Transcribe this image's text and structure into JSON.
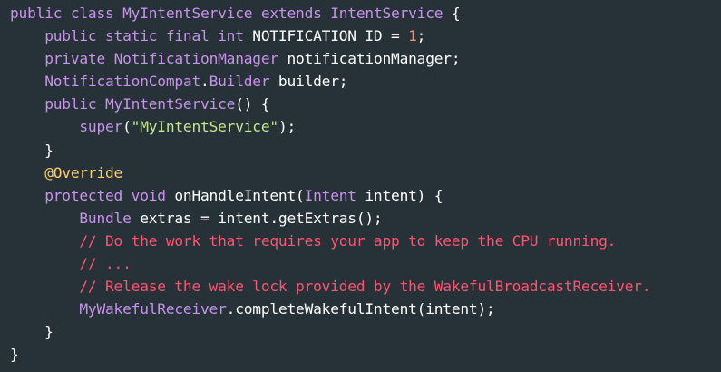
{
  "colors": {
    "background": "#263238",
    "keyword": "#c792ea",
    "type": "#c792ea",
    "plain": "#ffffff",
    "string": "#c3e88d",
    "number": "#f78c6c",
    "annotation": "#ffcb6b",
    "comment": "#ff5370"
  },
  "code": {
    "lines": [
      [
        {
          "cls": "tok-kw",
          "t": "public class "
        },
        {
          "cls": "tok-type",
          "t": "MyIntentService"
        },
        {
          "cls": "tok-kw",
          "t": " extends "
        },
        {
          "cls": "tok-type",
          "t": "IntentService"
        },
        {
          "cls": "tok-plain",
          "t": " {"
        }
      ],
      [
        {
          "cls": "tok-plain",
          "t": "    "
        },
        {
          "cls": "tok-kw",
          "t": "public static final int"
        },
        {
          "cls": "tok-plain",
          "t": " NOTIFICATION_ID = "
        },
        {
          "cls": "tok-num",
          "t": "1"
        },
        {
          "cls": "tok-plain",
          "t": ";"
        }
      ],
      [
        {
          "cls": "tok-plain",
          "t": "    "
        },
        {
          "cls": "tok-kw",
          "t": "private "
        },
        {
          "cls": "tok-type",
          "t": "NotificationManager"
        },
        {
          "cls": "tok-plain",
          "t": " notificationManager;"
        }
      ],
      [
        {
          "cls": "tok-plain",
          "t": "    "
        },
        {
          "cls": "tok-type",
          "t": "NotificationCompat"
        },
        {
          "cls": "tok-plain",
          "t": "."
        },
        {
          "cls": "tok-type",
          "t": "Builder"
        },
        {
          "cls": "tok-plain",
          "t": " builder;"
        }
      ],
      [
        {
          "cls": "tok-plain",
          "t": "    "
        },
        {
          "cls": "tok-kw",
          "t": "public "
        },
        {
          "cls": "tok-type",
          "t": "MyIntentService"
        },
        {
          "cls": "tok-plain",
          "t": "() {"
        }
      ],
      [
        {
          "cls": "tok-plain",
          "t": "        "
        },
        {
          "cls": "tok-kw",
          "t": "super"
        },
        {
          "cls": "tok-plain",
          "t": "("
        },
        {
          "cls": "tok-str",
          "t": "\"MyIntentService\""
        },
        {
          "cls": "tok-plain",
          "t": ");"
        }
      ],
      [
        {
          "cls": "tok-plain",
          "t": "    }"
        }
      ],
      [
        {
          "cls": "tok-plain",
          "t": "    "
        },
        {
          "cls": "tok-ann",
          "t": "@Override"
        }
      ],
      [
        {
          "cls": "tok-plain",
          "t": "    "
        },
        {
          "cls": "tok-kw",
          "t": "protected void"
        },
        {
          "cls": "tok-plain",
          "t": " onHandleIntent("
        },
        {
          "cls": "tok-type",
          "t": "Intent"
        },
        {
          "cls": "tok-plain",
          "t": " intent) {"
        }
      ],
      [
        {
          "cls": "tok-plain",
          "t": "        "
        },
        {
          "cls": "tok-type",
          "t": "Bundle"
        },
        {
          "cls": "tok-plain",
          "t": " extras = intent.getExtras();"
        }
      ],
      [
        {
          "cls": "tok-plain",
          "t": "        "
        },
        {
          "cls": "tok-com",
          "t": "// Do the work that requires your app to keep the CPU running."
        }
      ],
      [
        {
          "cls": "tok-plain",
          "t": "        "
        },
        {
          "cls": "tok-com",
          "t": "// ..."
        }
      ],
      [
        {
          "cls": "tok-plain",
          "t": "        "
        },
        {
          "cls": "tok-com",
          "t": "// Release the wake lock provided by the WakefulBroadcastReceiver."
        }
      ],
      [
        {
          "cls": "tok-plain",
          "t": "        "
        },
        {
          "cls": "tok-type",
          "t": "MyWakefulReceiver"
        },
        {
          "cls": "tok-plain",
          "t": ".completeWakefulIntent(intent);"
        }
      ],
      [
        {
          "cls": "tok-plain",
          "t": "    }"
        }
      ],
      [
        {
          "cls": "tok-plain",
          "t": "}"
        }
      ]
    ]
  }
}
